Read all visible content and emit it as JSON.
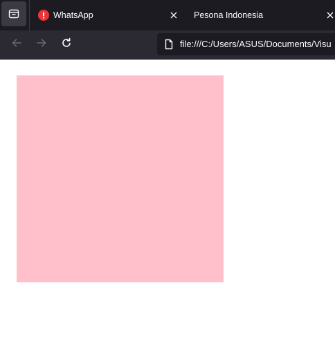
{
  "tabs": [
    {
      "title": "WhatsApp",
      "favicon": "alert-icon",
      "favicon_color": "#e22850"
    },
    {
      "title": "Pesona Indonesia"
    }
  ],
  "toolbar": {
    "tab_list_icon": "tab-list-icon",
    "back_icon": "arrow-left-icon",
    "forward_icon": "arrow-right-icon",
    "reload_icon": "reload-icon",
    "close_icon": "close-icon"
  },
  "urlbar": {
    "page_icon": "page-icon",
    "url": "file:///C:/Users/ASUS/Documents/Visu"
  },
  "page": {
    "box_color": "#ffc0cb"
  },
  "colors": {
    "tabstrip_bg": "#1c1b22",
    "navbar_bg": "#2b2a33",
    "text": "#fbfbfe",
    "page_bg": "#ffffff"
  }
}
